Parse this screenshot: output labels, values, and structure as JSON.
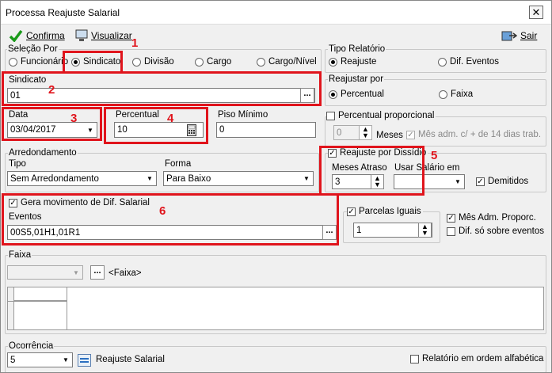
{
  "window": {
    "title": "Processa Reajuste Salarial",
    "close": "✕"
  },
  "toolbar": {
    "confirma": "Confirma",
    "visualizar": "Visualizar",
    "sair": "Sair"
  },
  "selecao": {
    "label": "Seleção Por",
    "options": [
      "Funcionário",
      "Sindicato",
      "Divisão",
      "Cargo",
      "Cargo/Nível"
    ],
    "selected": "Sindicato"
  },
  "tipo_relatorio": {
    "label": "Tipo Relatório",
    "options": [
      "Reajuste",
      "Dif. Eventos"
    ],
    "selected": "Reajuste"
  },
  "sindicato": {
    "label": "Sindicato",
    "value": "01"
  },
  "reajustar": {
    "label": "Reajustar por",
    "options": [
      "Percentual",
      "Faixa"
    ],
    "selected": "Percentual"
  },
  "data": {
    "label": "Data",
    "value": "03/04/2017"
  },
  "percentual": {
    "label": "Percentual",
    "value": "10"
  },
  "piso": {
    "label": "Piso Mínimo",
    "value": "0"
  },
  "percentual_proporcional": {
    "label": "Percentual proporcional",
    "checked": false,
    "meses_value": "0",
    "meses_label": "Meses",
    "mes_adm": "Mês adm. c/ + de 14 dias trab."
  },
  "arredondamento": {
    "label": "Arredondamento",
    "tipo_label": "Tipo",
    "tipo_value": "Sem Arredondamento",
    "forma_label": "Forma",
    "forma_value": "Para Baixo"
  },
  "dissidio": {
    "label": "Reajuste por Dissídio",
    "checked": true,
    "meses_atraso_label": "Meses Atraso",
    "meses_atraso_value": "3",
    "usar_salario_label": "Usar Salário em",
    "usar_salario_value": "",
    "demitidos": "Demitidos"
  },
  "gera": {
    "label": "Gera movimento de Dif. Salarial",
    "checked": true,
    "eventos_label": "Eventos",
    "eventos_value": "00S5,01H1,01R1"
  },
  "parcelas": {
    "label": "Parcelas Iguais",
    "checked": true,
    "value": "1",
    "mes_adm_proporc": "Mês Adm. Proporc.",
    "mes_adm_checked": true,
    "dif_so": "Dif. só sobre eventos",
    "dif_checked": false
  },
  "faixa": {
    "label": "Faixa",
    "value": "",
    "placeholder": "<Faixa>"
  },
  "ocorrencia": {
    "label": "Ocorrência",
    "value": "5",
    "desc": "Reajuste Salarial"
  },
  "relatorio_alfabetica": {
    "label": "Relatório em ordem alfabética",
    "checked": false
  },
  "annotations": [
    "1",
    "2",
    "3",
    "4",
    "5",
    "6"
  ],
  "colors": {
    "annotation": "#e0141c",
    "window_bg": "#f0f0f0"
  }
}
